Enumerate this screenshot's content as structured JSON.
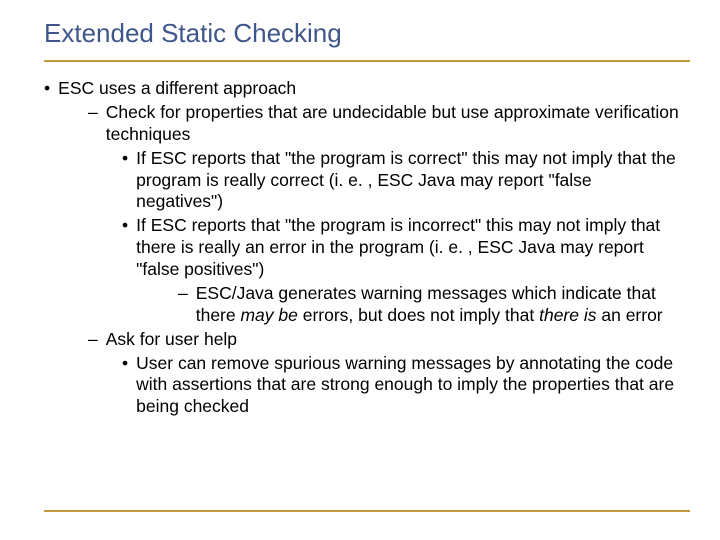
{
  "title": "Extended Static Checking",
  "b0": "ESC uses a different approach",
  "b1": "Check for properties that are undecidable but use approximate verification techniques",
  "b2a": "If ESC reports that \"the program is correct\" this may not imply that the program is really correct (i. e. , ESC Java may report \"false negatives\")",
  "b2b": "If ESC reports that \"the program is incorrect\" this may not imply that there is really an error in the program (i. e. , ESC Java may report  \"false positives\")",
  "b3_pre": "ESC/Java generates warning messages which indicate that there ",
  "b3_i1": "may be",
  "b3_mid": " errors, but does not imply that ",
  "b3_i2": "there is",
  "b3_post": " an error",
  "b4": "Ask for user help",
  "b5": "User can remove spurious warning messages by annotating the code with assertions that are strong enough to imply the properties that are being checked",
  "bul_dot": "•",
  "bul_dash": "–"
}
